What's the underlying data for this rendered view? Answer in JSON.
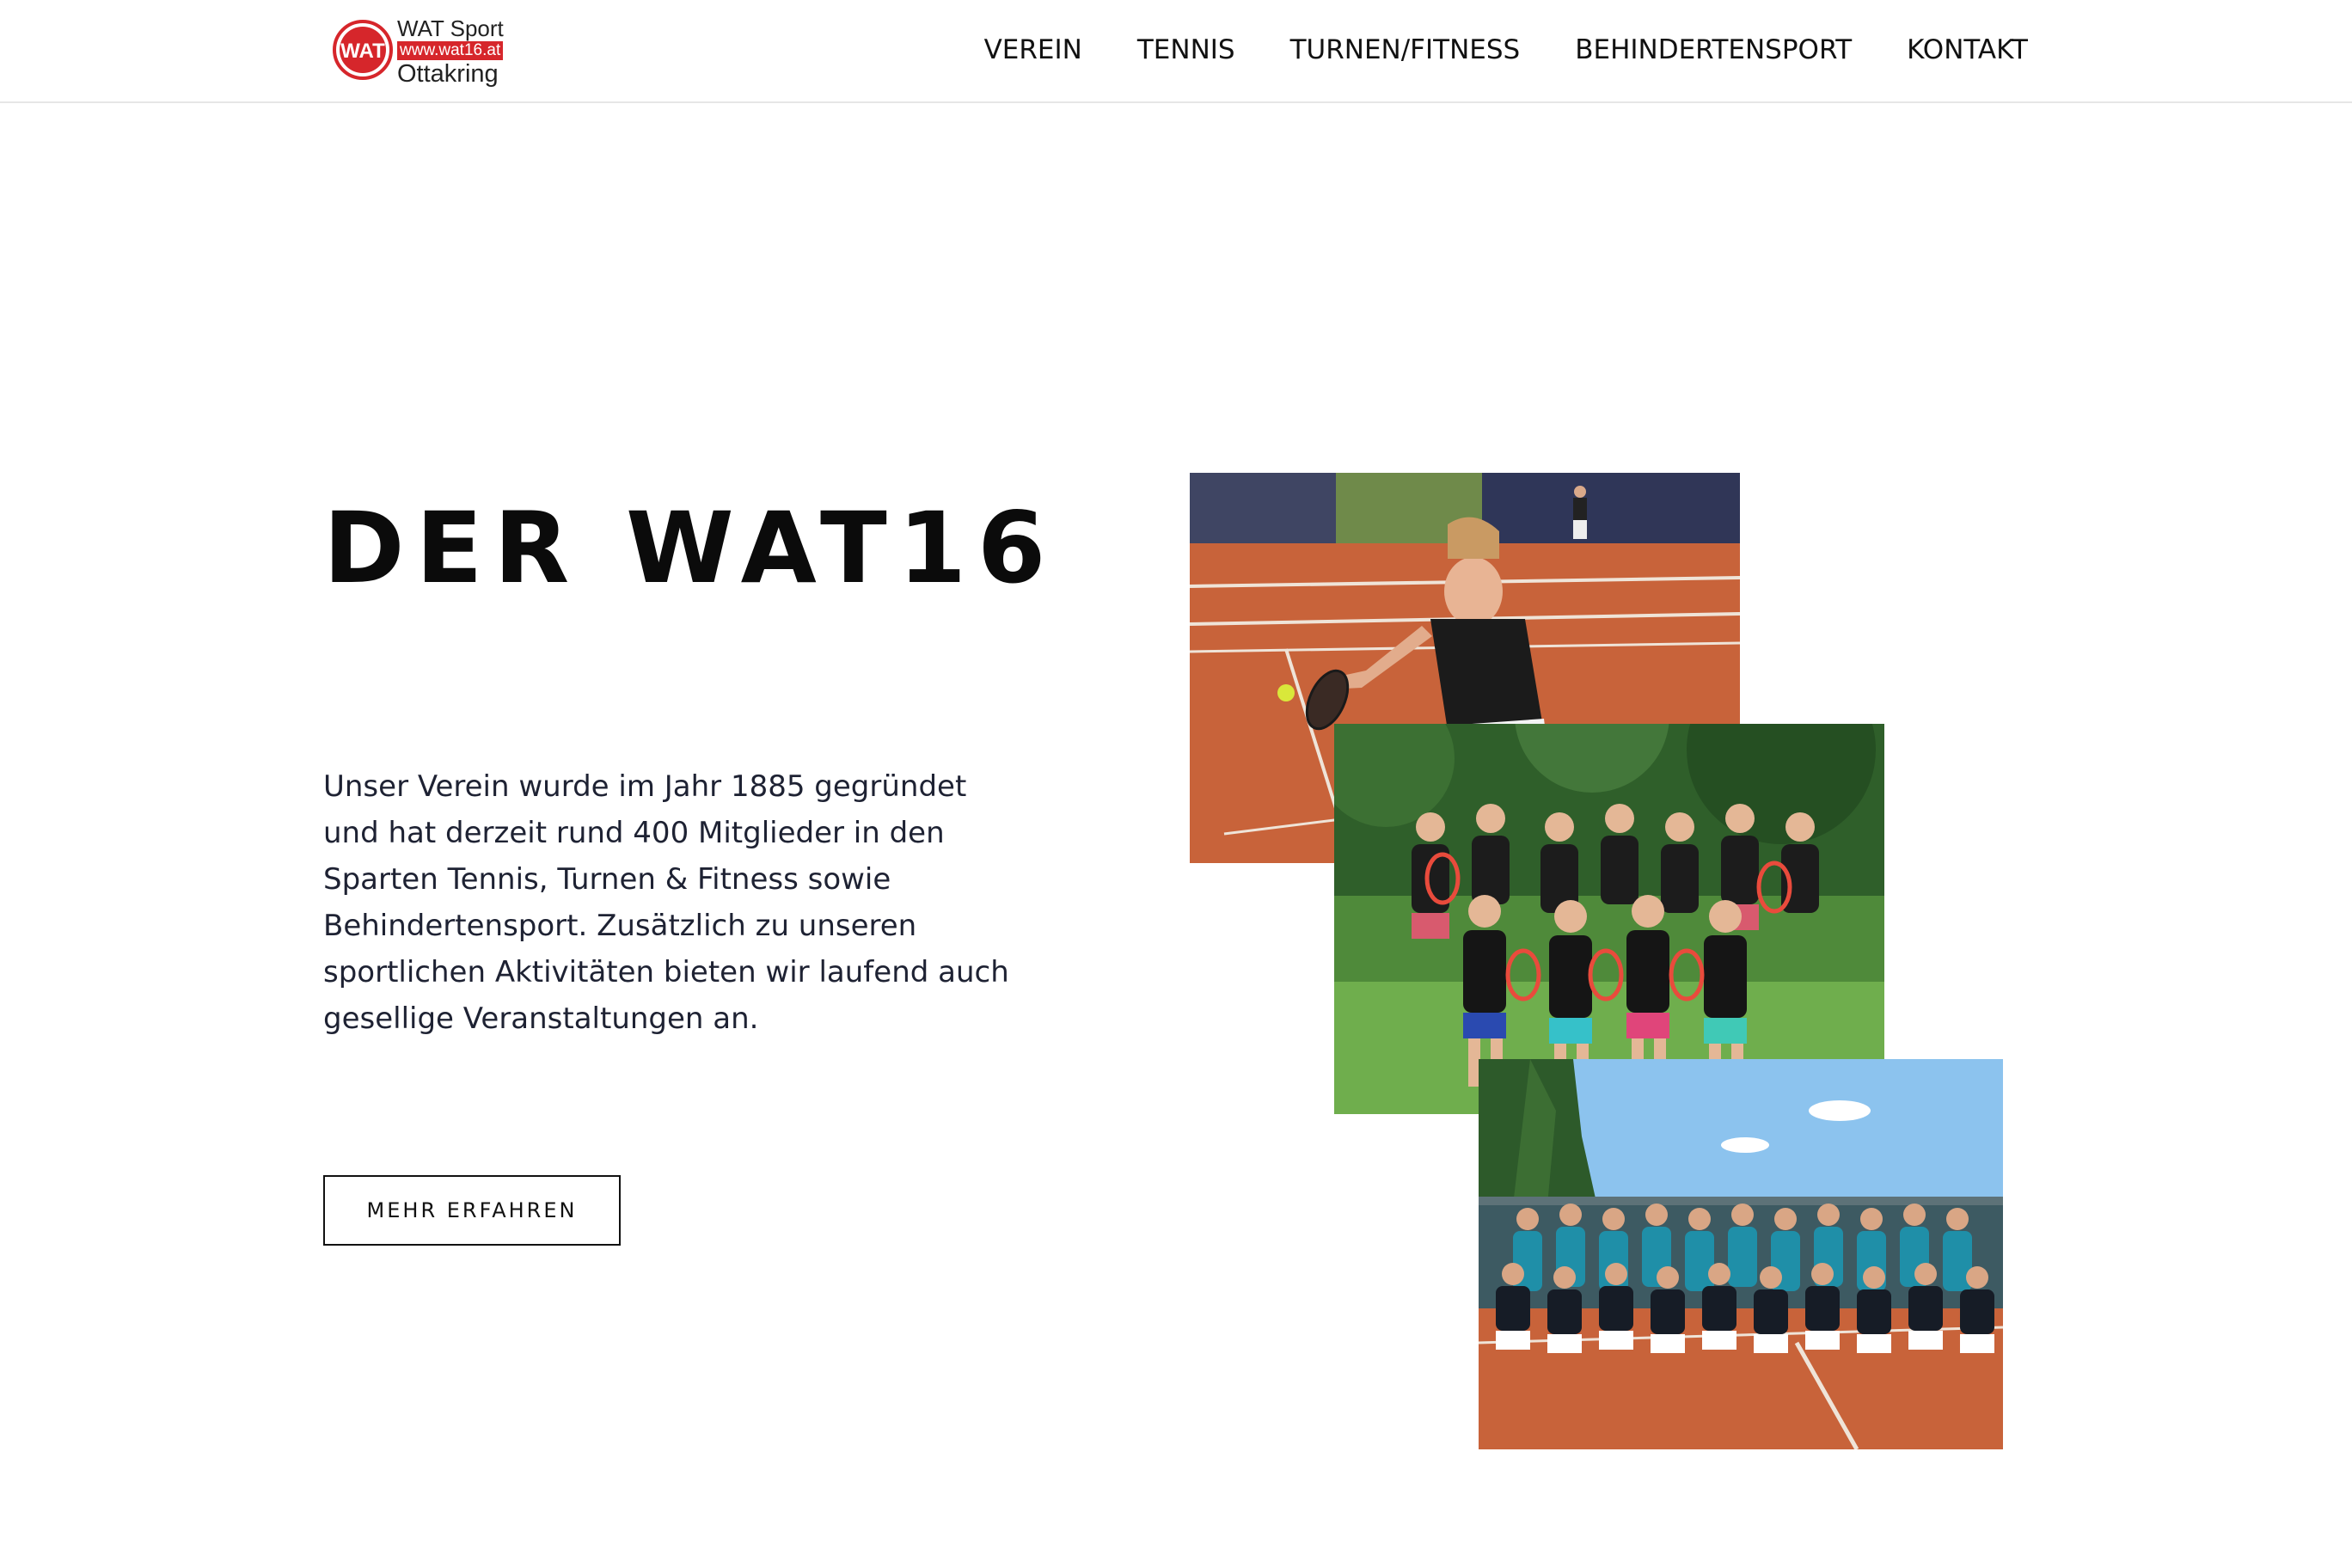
{
  "header": {
    "logo": {
      "title": "WAT Sport",
      "url": "www.wat16.at",
      "subtitle": "Ottakring",
      "mark_text": "WAT",
      "mark_color": "#d6262b"
    },
    "nav": [
      {
        "label": "VEREIN"
      },
      {
        "label": "TENNIS"
      },
      {
        "label": "TURNEN/FITNESS"
      },
      {
        "label": "BEHINDERTENSPORT"
      },
      {
        "label": "KONTAKT"
      }
    ]
  },
  "hero": {
    "title": "DER WAT16",
    "text": "Unser Verein wurde im Jahr 1885 gegründet und hat derzeit rund 400 Mitglieder in den Sparten Tennis, Turnen & Fitness sowie Behindertensport. Zusätzlich zu unseren sportlichen Aktivitäten bieten wir laufend auch gesellige Veranstaltungen an.",
    "button_label": "MEHR ERFAHREN"
  },
  "gallery": {
    "photos": [
      {
        "name": "tennis-player-photo"
      },
      {
        "name": "womens-team-photo"
      },
      {
        "name": "mens-team-photo"
      }
    ]
  },
  "colors": {
    "clay": "#c8633a",
    "grass": "#4f8a3a",
    "sky": "#8cc3ee",
    "brand_red": "#d6262b"
  }
}
